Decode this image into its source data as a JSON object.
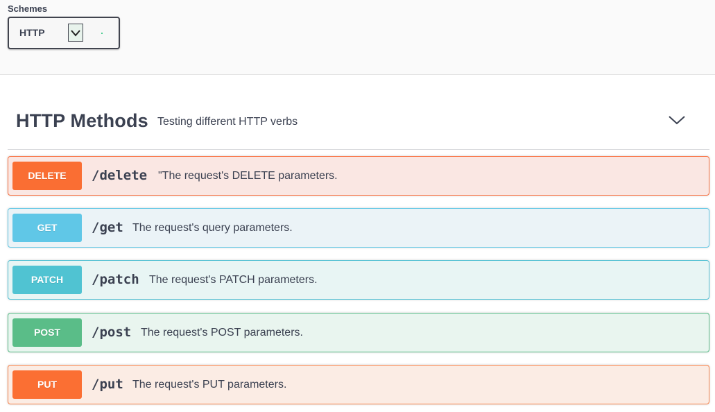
{
  "schemes": {
    "label": "Schemes",
    "selected": "HTTP"
  },
  "section": {
    "title": "HTTP Methods",
    "description": "Testing different HTTP verbs"
  },
  "operations": [
    {
      "method": "DELETE",
      "path": "/delete",
      "summary": "\"The request's DELETE parameters.",
      "color": "#fa6e33"
    },
    {
      "method": "GET",
      "path": "/get",
      "summary": "The request's query parameters.",
      "color": "#60c7e7"
    },
    {
      "method": "PATCH",
      "path": "/patch",
      "summary": "The request's PATCH parameters.",
      "color": "#50c3d2"
    },
    {
      "method": "POST",
      "path": "/post",
      "summary": "The request's POST parameters.",
      "color": "#5abd88"
    },
    {
      "method": "PUT",
      "path": "/put",
      "summary": "The request's PUT parameters.",
      "color": "#fb6f33"
    }
  ],
  "icons": {
    "scheme_dropdown": "chevron-down-icon",
    "section_toggle": "chevron-down-icon"
  }
}
